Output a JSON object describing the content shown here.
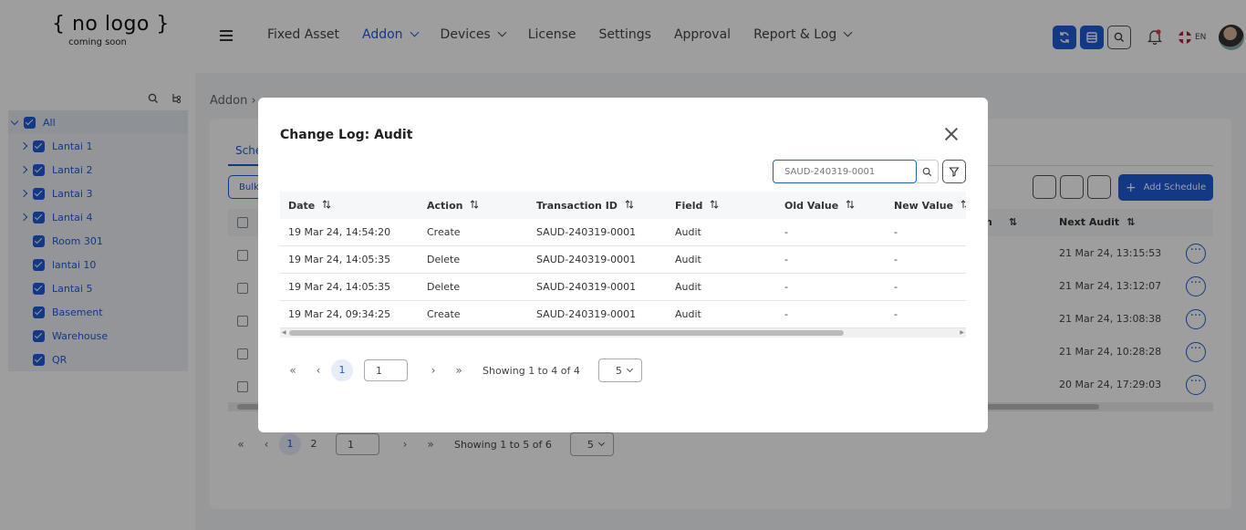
{
  "header": {
    "logo_main": "{ no logo }",
    "logo_sub": "coming soon",
    "nav": [
      {
        "label": "Fixed Asset",
        "dropdown": false,
        "active": false
      },
      {
        "label": "Addon",
        "dropdown": true,
        "active": true
      },
      {
        "label": "Devices",
        "dropdown": true,
        "active": false
      },
      {
        "label": "License",
        "dropdown": false,
        "active": false
      },
      {
        "label": "Settings",
        "dropdown": false,
        "active": false
      },
      {
        "label": "Approval",
        "dropdown": false,
        "active": false
      },
      {
        "label": "Report & Log",
        "dropdown": true,
        "active": false
      }
    ],
    "lang": "EN"
  },
  "sidebar": {
    "tree": [
      {
        "label": "All",
        "expand": "down",
        "root": true
      },
      {
        "label": "Lantai 1",
        "expand": "right"
      },
      {
        "label": "Lantai 2",
        "expand": "right"
      },
      {
        "label": "Lantai 3",
        "expand": "right"
      },
      {
        "label": "Lantai 4",
        "expand": "right"
      },
      {
        "label": "Room 301",
        "expand": ""
      },
      {
        "label": "lantai 10",
        "expand": ""
      },
      {
        "label": "Lantai 5",
        "expand": ""
      },
      {
        "label": "Basement",
        "expand": ""
      },
      {
        "label": "Warehouse",
        "expand": ""
      },
      {
        "label": "QR",
        "expand": ""
      }
    ]
  },
  "main": {
    "breadcrumb": "Addon ›",
    "tab_label": "Sche",
    "bulk_label": "Bulk",
    "add_schedule": "Add Schedule",
    "col_partial": "n",
    "col_next_audit": "Next Audit",
    "next_audits": [
      "21 Mar 24, 13:15:53",
      "21 Mar 24, 13:12:07",
      "21 Mar 24, 13:08:38",
      "21 Mar 24, 10:28:28",
      "20 Mar 24, 17:29:03"
    ],
    "pagination": {
      "pages": [
        "1",
        "2"
      ],
      "current": "1",
      "showing": "Showing 1 to 5 of 6",
      "page_size": "5"
    }
  },
  "modal": {
    "title": "Change Log: Audit",
    "search_value": "SAUD-240319-0001",
    "columns": [
      "Date",
      "Action",
      "Transaction ID",
      "Field",
      "Old Value",
      "New Value"
    ],
    "rows": [
      [
        "19 Mar 24, 14:54:20",
        "Create",
        "SAUD-240319-0001",
        "Audit",
        "-",
        "-"
      ],
      [
        "19 Mar 24, 14:05:35",
        "Delete",
        "SAUD-240319-0001",
        "Audit",
        "-",
        "-"
      ],
      [
        "19 Mar 24, 14:05:35",
        "Delete",
        "SAUD-240319-0001",
        "Audit",
        "-",
        "-"
      ],
      [
        "19 Mar 24, 09:34:25",
        "Create",
        "SAUD-240319-0001",
        "Audit",
        "-",
        "-"
      ]
    ],
    "pagination": {
      "current": "1",
      "page_input": "1",
      "showing": "Showing 1 to 4 of 4",
      "page_size": "5"
    }
  },
  "colors": {
    "accent": "#1e5bd8",
    "overlay": "rgba(0,0,0,0.38)"
  }
}
